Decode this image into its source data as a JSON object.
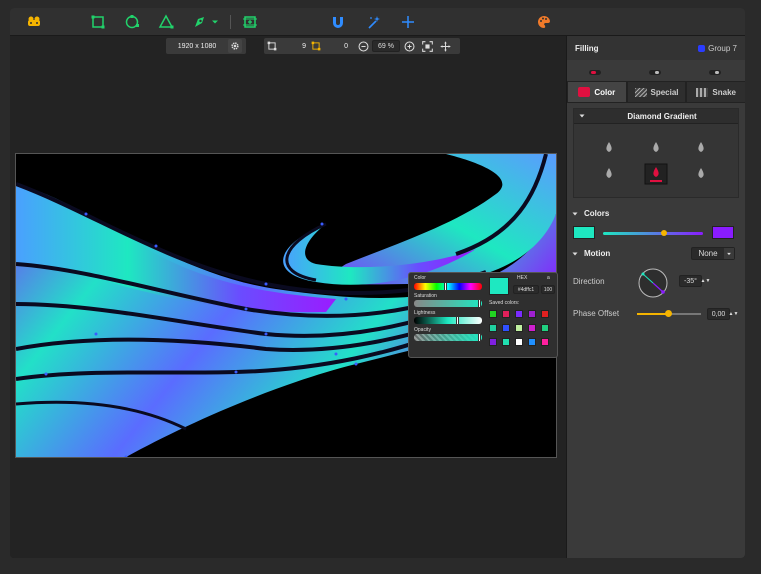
{
  "toolbar": {
    "tools": [
      {
        "icon": "rocket-icon",
        "color": "#f5b400"
      },
      {
        "icon": "rectangle-tool-icon",
        "color": "#21d36b"
      },
      {
        "icon": "ellipse-tool-icon",
        "color": "#21d36b"
      },
      {
        "icon": "triangle-tool-icon",
        "color": "#21d36b"
      },
      {
        "icon": "pen-tool-icon",
        "color": "#21d36b"
      },
      {
        "icon": "chevron-down-icon",
        "color": "#21d36b"
      },
      {
        "icon": "artboard-tool-icon",
        "color": "#21d36b"
      },
      {
        "icon": "magnet-icon",
        "color": "#2f8cff"
      },
      {
        "icon": "magic-wand-icon",
        "color": "#2f8cff"
      },
      {
        "icon": "crosshair-icon",
        "color": "#2f8cff"
      },
      {
        "icon": "palette-icon",
        "color": "#f07a2a"
      }
    ]
  },
  "subbar": {
    "resolution": "1920 x 1080",
    "count_a": "9",
    "count_b": "0",
    "zoom": "69 %"
  },
  "panel": {
    "title": "Filling",
    "group": "Group 7",
    "group_color": "#2a3cff",
    "tabs": [
      {
        "label": "Color",
        "icon": "color-tab-icon"
      },
      {
        "label": "Special",
        "icon": "special-tab-icon"
      },
      {
        "label": "Snake",
        "icon": "snake-tab-icon"
      }
    ],
    "gradient_type": "Diamond Gradient",
    "colors_title": "Colors",
    "color_start": "#1ee8c1",
    "color_end": "#8a1cff",
    "motion_title": "Motion",
    "motion_value": "None",
    "direction_label": "Direction",
    "direction_value": "-35°",
    "phase_label": "Phase Offset",
    "phase_value": "0,00"
  },
  "picker": {
    "color_label": "Color",
    "saturation_label": "Saturation",
    "lightness_label": "Lightness",
    "opacity_label": "Opacity",
    "hex_label": "HEX",
    "alpha_label": "a",
    "hex_value": "#4dffc1",
    "alpha_value": "100",
    "saved_label": "Saved colors:",
    "current_color": "#1ee8c1",
    "saved_colors": [
      "#22d322",
      "#e0205a",
      "#7a2cff",
      "#a020d0",
      "#e02020",
      "#20d0a0",
      "#3050ff",
      "#c0f0a0",
      "#d020d0",
      "#20d080",
      "#8020e0",
      "#20e0b0",
      "#ffffff",
      "#2090ff",
      "#ff20a0"
    ]
  }
}
